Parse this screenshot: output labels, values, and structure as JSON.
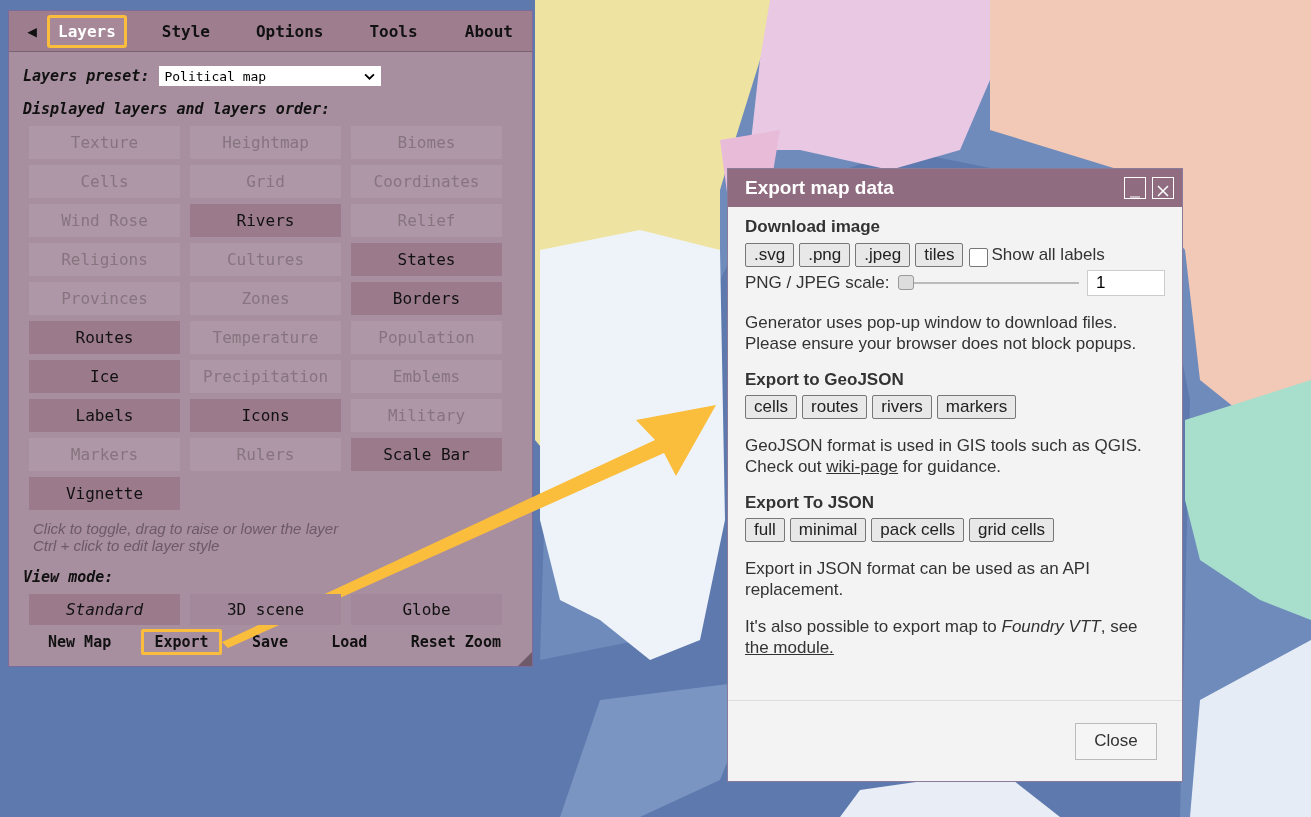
{
  "menu_panel": {
    "back_glyph": "◀",
    "tabs": [
      {
        "label": "Layers",
        "selected": true,
        "highlighted": true
      },
      {
        "label": "Style",
        "selected": false,
        "highlighted": false
      },
      {
        "label": "Options",
        "selected": false,
        "highlighted": false
      },
      {
        "label": "Tools",
        "selected": false,
        "highlighted": false
      },
      {
        "label": "About",
        "selected": false,
        "highlighted": false
      }
    ],
    "preset_label": "Layers preset:",
    "preset_value": "Political map",
    "layers_heading": "Displayed layers and layers order:",
    "layers": [
      {
        "label": "Texture",
        "on": false
      },
      {
        "label": "Heightmap",
        "on": false
      },
      {
        "label": "Biomes",
        "on": false
      },
      {
        "label": "Cells",
        "on": false
      },
      {
        "label": "Grid",
        "on": false
      },
      {
        "label": "Coordinates",
        "on": false
      },
      {
        "label": "Wind Rose",
        "on": false
      },
      {
        "label": "Rivers",
        "on": true
      },
      {
        "label": "Relief",
        "on": false
      },
      {
        "label": "Religions",
        "on": false
      },
      {
        "label": "Cultures",
        "on": false
      },
      {
        "label": "States",
        "on": true
      },
      {
        "label": "Provinces",
        "on": false
      },
      {
        "label": "Zones",
        "on": false
      },
      {
        "label": "Borders",
        "on": true
      },
      {
        "label": "Routes",
        "on": true
      },
      {
        "label": "Temperature",
        "on": false
      },
      {
        "label": "Population",
        "on": false
      },
      {
        "label": "Ice",
        "on": true
      },
      {
        "label": "Precipitation",
        "on": false
      },
      {
        "label": "Emblems",
        "on": false
      },
      {
        "label": "Labels",
        "on": true
      },
      {
        "label": "Icons",
        "on": true
      },
      {
        "label": "Military",
        "on": false
      },
      {
        "label": "Markers",
        "on": false
      },
      {
        "label": "Rulers",
        "on": false
      },
      {
        "label": "Scale Bar",
        "on": true
      },
      {
        "label": "Vignette",
        "on": true
      }
    ],
    "hint_lines": [
      "Click to toggle, drag to raise or lower the layer",
      "Ctrl + click to edit layer style"
    ],
    "view_mode_label": "View mode:",
    "view_modes": [
      {
        "label": "Standard",
        "selected": true
      },
      {
        "label": "3D scene",
        "selected": false
      },
      {
        "label": "Globe",
        "selected": false
      }
    ],
    "actions": [
      {
        "label": "New Map",
        "highlighted": false
      },
      {
        "label": "Export",
        "highlighted": true
      },
      {
        "label": "Save",
        "highlighted": false
      },
      {
        "label": "Load",
        "highlighted": false
      },
      {
        "label": "Reset Zoom",
        "highlighted": false
      }
    ]
  },
  "dialog": {
    "title": "Export map data",
    "sections": [
      {
        "heading": "Download image",
        "buttons": [
          ".svg",
          ".png",
          ".jpeg",
          "tiles"
        ],
        "checkbox": {
          "label": "Show all labels",
          "checked": false
        },
        "scale": {
          "label": "PNG / JPEG scale:",
          "level": 0,
          "value": "1"
        },
        "note": [
          {
            "text": "Generator uses pop-up window to download files."
          },
          {
            "text": "Please ensure your browser does not block popups."
          }
        ]
      },
      {
        "heading": "Export to GeoJSON",
        "buttons": [
          "cells",
          "routes",
          "rivers",
          "markers"
        ],
        "note": [
          {
            "text": "GeoJSON format is used in GIS tools such as QGIS."
          },
          {
            "text": "Check out ",
            "link": "wiki-page",
            "after": " for guidance."
          }
        ]
      },
      {
        "heading": "Export To JSON",
        "buttons": [
          "full",
          "minimal",
          "pack cells",
          "grid cells"
        ],
        "note": [
          {
            "text": "Export in JSON format can be used as an API replacement."
          }
        ]
      },
      {
        "note": [
          {
            "text": "It's also possible to export map to *Foundry VTT*, see ",
            "link": "the module."
          }
        ]
      }
    ],
    "close_button": "Close"
  }
}
